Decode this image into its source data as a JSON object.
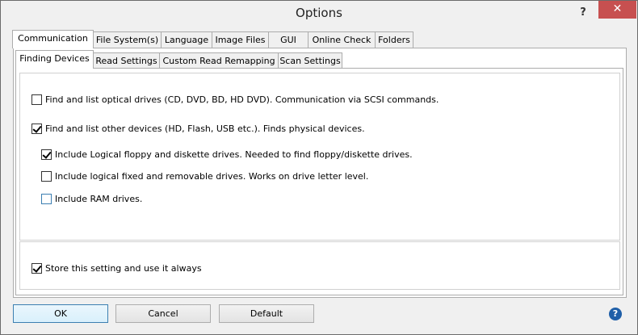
{
  "window": {
    "title": "Options"
  },
  "titlebar": {
    "help_glyph": "?",
    "close_glyph": "✕"
  },
  "tabs_main": [
    {
      "label": "Communication",
      "active": true
    },
    {
      "label": "File System(s)"
    },
    {
      "label": "Language"
    },
    {
      "label": "Image Files"
    },
    {
      "label": "GUI"
    },
    {
      "label": "Online Check"
    },
    {
      "label": "Folders"
    }
  ],
  "tabs_sub": [
    {
      "label": "Finding Devices",
      "active": true
    },
    {
      "label": "Read Settings"
    },
    {
      "label": "Custom Read Remapping"
    },
    {
      "label": "Scan Settings"
    }
  ],
  "options": {
    "optical": {
      "label": "Find and list optical drives (CD, DVD, BD, HD DVD).  Communication via SCSI commands.",
      "checked": false
    },
    "other": {
      "label": "Find and list other devices (HD, Flash, USB etc.).  Finds physical devices.",
      "checked": true
    },
    "logical_floppy": {
      "label": "Include Logical floppy and diskette drives.  Needed to find floppy/diskette drives.",
      "checked": true
    },
    "logical_fixed": {
      "label": "Include logical fixed and removable drives.  Works on drive letter level.",
      "checked": false
    },
    "ram": {
      "label": "Include RAM drives.",
      "checked": false
    }
  },
  "store": {
    "label": "Store this setting and use it always",
    "checked": true
  },
  "buttons": {
    "ok": "OK",
    "cancel": "Cancel",
    "default": "Default"
  },
  "help": {
    "glyph": "?"
  },
  "colors": {
    "close_bg": "#c75050",
    "focus_border": "#3c7fb1",
    "help_icon": "#1f5fa8"
  }
}
